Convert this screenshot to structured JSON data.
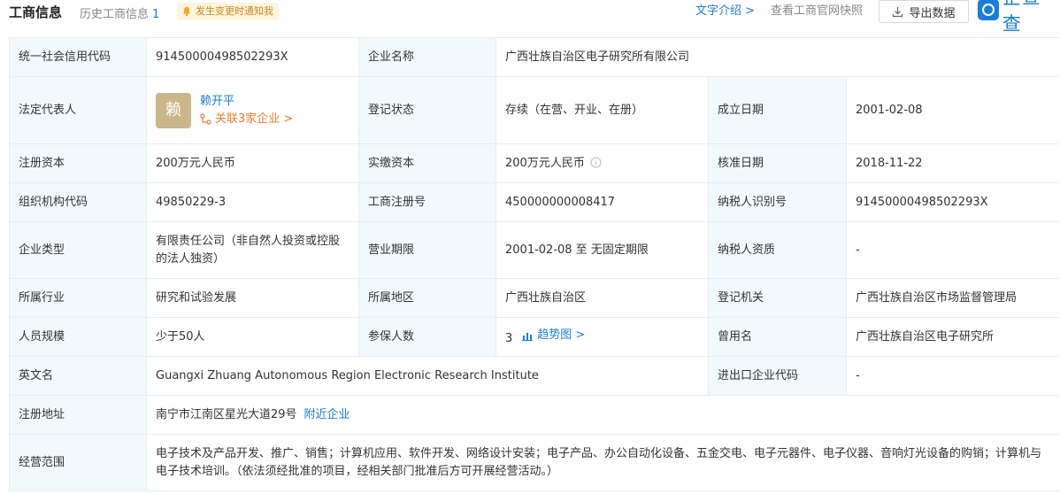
{
  "header": {
    "title": "工商信息",
    "history_label": "历史工商信息",
    "history_count": "1",
    "notify_label": "发生变更时通知我",
    "text_intro_link": "文字介绍 >",
    "official_snapshot_link": "查看工商官网快照",
    "export_label": "导出数据",
    "logo_text": "企查查"
  },
  "rows": {
    "credit_code": {
      "label": "统一社会信用代码",
      "value": "91450000498502293X"
    },
    "company_name": {
      "label": "企业名称",
      "value": "广西壮族自治区电子研究所有限公司"
    },
    "legal_rep": {
      "label": "法定代表人",
      "avatar_char": "赖",
      "name": "赖开平",
      "related": "关联3家企业 >"
    },
    "reg_status": {
      "label": "登记状态",
      "value": "存续（在营、开业、在册）"
    },
    "founded": {
      "label": "成立日期",
      "value": "2001-02-08"
    },
    "reg_capital": {
      "label": "注册资本",
      "value": "200万元人民币"
    },
    "paid_capital": {
      "label": "实缴资本",
      "value": "200万元人民币"
    },
    "approval_date": {
      "label": "核准日期",
      "value": "2018-11-22"
    },
    "org_code": {
      "label": "组织机构代码",
      "value": "49850229-3"
    },
    "reg_number": {
      "label": "工商注册号",
      "value": "450000000008417"
    },
    "taxpayer_id": {
      "label": "纳税人识别号",
      "value": "91450000498502293X"
    },
    "company_type": {
      "label": "企业类型",
      "value": "有限责任公司（非自然人投资或控股的法人独资）"
    },
    "business_term": {
      "label": "营业期限",
      "value": "2001-02-08 至 无固定期限"
    },
    "taxpayer_qual": {
      "label": "纳税人资质",
      "value": "-"
    },
    "industry": {
      "label": "所属行业",
      "value": "研究和试验发展"
    },
    "region": {
      "label": "所属地区",
      "value": "广西壮族自治区"
    },
    "reg_authority": {
      "label": "登记机关",
      "value": "广西壮族自治区市场监督管理局"
    },
    "staff_size": {
      "label": "人员规模",
      "value": "少于50人"
    },
    "insured": {
      "label": "参保人数",
      "value": "3",
      "trend_link": "趋势图 >"
    },
    "former_name": {
      "label": "曾用名",
      "value": "广西壮族自治区电子研究所"
    },
    "english_name": {
      "label": "英文名",
      "value": "Guangxi Zhuang Autonomous Region Electronic Research Institute"
    },
    "import_export": {
      "label": "进出口企业代码",
      "value": "-"
    },
    "address": {
      "label": "注册地址",
      "value": "南宁市江南区星光大道29号",
      "nearby_link": "附近企业"
    },
    "scope": {
      "label": "经营范围",
      "value": "电子技术及产品开发、推广、销售；计算机应用、软件开发、网络设计安装；电子产品、办公自动化设备、五金交电、电子元器件、电子仪器、音响灯光设备的购销；计算机与电子技术培训。（依法须经批准的项目，经相关部门批准后方可开展经营活动。）"
    }
  },
  "colors": {
    "label_bg": "#f2f9fc",
    "border": "#e4eef6",
    "link_blue": "#1a7ddb",
    "link_orange": "#f07c2c",
    "avatar_bg": "#c9b78a",
    "notify_bg": "#fff4dc"
  }
}
